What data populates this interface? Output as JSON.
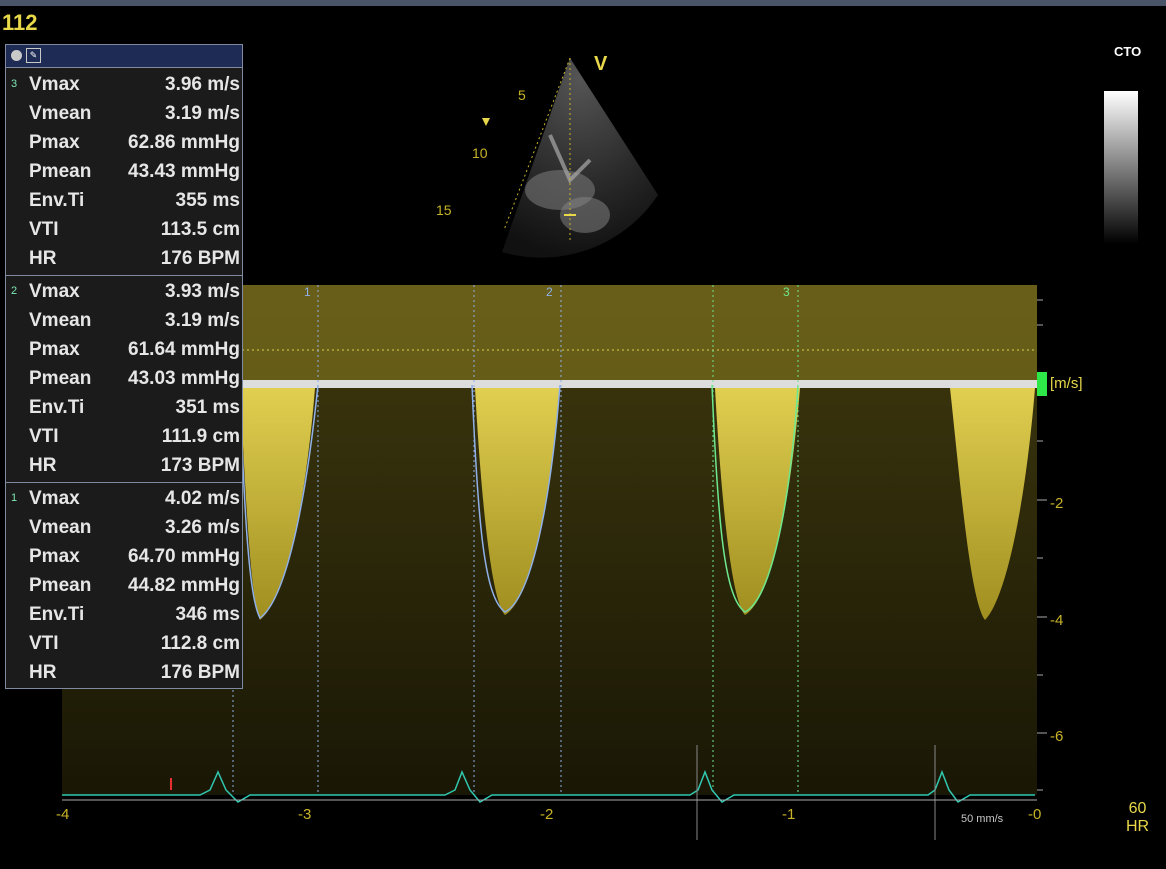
{
  "frame_number": "112",
  "gray_map_label": "CTO",
  "probe_label": "V",
  "depth_marks": [
    "5",
    "10",
    "15"
  ],
  "velocity_unit": "[m/s]",
  "velocity_ticks": [
    "-2",
    "-4",
    "-6"
  ],
  "time_ticks": [
    "-4",
    "-3",
    "-2",
    "-1",
    "-0"
  ],
  "cycle_markers": [
    "1",
    "2",
    "3"
  ],
  "sweep_speed": "50 mm/s",
  "heart_rate": {
    "value": "60",
    "unit": "HR"
  },
  "measurement_groups": [
    {
      "index": "3",
      "rows": [
        {
          "label": "Vmax",
          "value": "3.96 m/s"
        },
        {
          "label": "Vmean",
          "value": "3.19 m/s"
        },
        {
          "label": "Pmax",
          "value": "62.86 mmHg"
        },
        {
          "label": "Pmean",
          "value": "43.43 mmHg"
        },
        {
          "label": "Env.Ti",
          "value": "355 ms"
        },
        {
          "label": "VTI",
          "value": "113.5 cm"
        },
        {
          "label": "HR",
          "value": "176 BPM"
        }
      ]
    },
    {
      "index": "2",
      "rows": [
        {
          "label": "Vmax",
          "value": "3.93 m/s"
        },
        {
          "label": "Vmean",
          "value": "3.19 m/s"
        },
        {
          "label": "Pmax",
          "value": "61.64 mmHg"
        },
        {
          "label": "Pmean",
          "value": "43.03 mmHg"
        },
        {
          "label": "Env.Ti",
          "value": "351 ms"
        },
        {
          "label": "VTI",
          "value": "111.9 cm"
        },
        {
          "label": "HR",
          "value": "173 BPM"
        }
      ]
    },
    {
      "index": "1",
      "rows": [
        {
          "label": "Vmax",
          "value": "4.02 m/s"
        },
        {
          "label": "Vmean",
          "value": "3.26 m/s"
        },
        {
          "label": "Pmax",
          "value": "64.70 mmHg"
        },
        {
          "label": "Pmean",
          "value": "44.82 mmHg"
        },
        {
          "label": "Env.Ti",
          "value": "346 ms"
        },
        {
          "label": "VTI",
          "value": "112.8 cm"
        },
        {
          "label": "HR",
          "value": "176 BPM"
        }
      ]
    }
  ],
  "colors": {
    "doppler": "#c8b428",
    "envelope_1": "#8fb0e8",
    "envelope_3": "#6ee88e",
    "ecg": "#30c8b0",
    "text_accent": "#e8d84a"
  }
}
